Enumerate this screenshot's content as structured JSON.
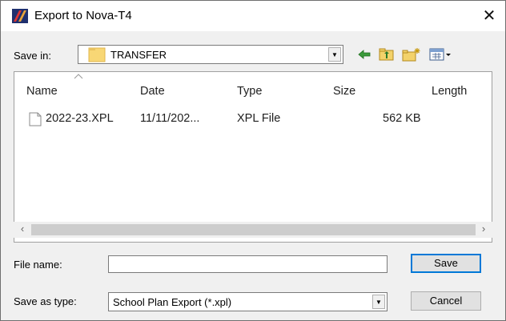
{
  "window": {
    "title": "Export to Nova-T4",
    "close_glyph": "✕"
  },
  "save_in": {
    "label": "Save in:",
    "folder": "TRANSFER"
  },
  "toolbar": {
    "icons": [
      "back-arrow-icon",
      "up-folder-icon",
      "new-folder-icon",
      "view-menu-icon"
    ]
  },
  "columns": [
    "Name",
    "Date",
    "Type",
    "Size",
    "Length"
  ],
  "files": [
    {
      "name": "2022-23.XPL",
      "date": "11/11/202...",
      "type": "XPL File",
      "size": "562 KB",
      "length": ""
    }
  ],
  "file_name": {
    "label": "File name:",
    "value": ""
  },
  "save_as_type": {
    "label": "Save as type:",
    "value": "School Plan Export (*.xpl)"
  },
  "buttons": {
    "save": "Save",
    "cancel": "Cancel"
  },
  "colors": {
    "accent_blue": "#0078d7",
    "dialog_bg": "#f0f0f0",
    "folder_yellow": "#f8d775"
  }
}
